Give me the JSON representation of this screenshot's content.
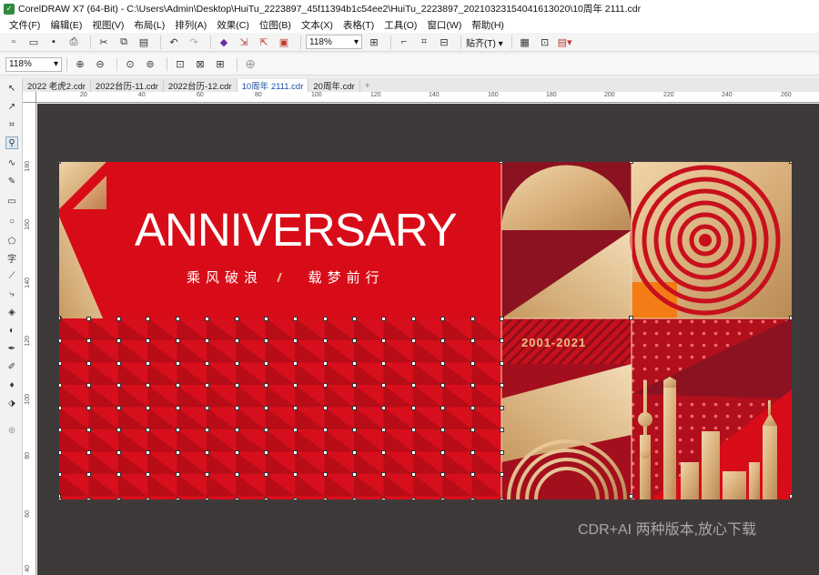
{
  "titlebar": {
    "title": "CorelDRAW X7 (64-Bit) - C:\\Users\\Admin\\Desktop\\HuiTu_2223897_45f11394b1c54ee2\\HuiTu_2223897_20210323154041613020\\10周年 2111.cdr"
  },
  "menu": {
    "items": [
      {
        "label": "文件(F)"
      },
      {
        "label": "编辑(E)"
      },
      {
        "label": "视图(V)"
      },
      {
        "label": "布局(L)"
      },
      {
        "label": "排列(A)"
      },
      {
        "label": "效果(C)"
      },
      {
        "label": "位图(B)"
      },
      {
        "label": "文本(X)"
      },
      {
        "label": "表格(T)"
      },
      {
        "label": "工具(O)"
      },
      {
        "label": "窗口(W)"
      },
      {
        "label": "帮助(H)"
      }
    ]
  },
  "toolbar": {
    "zoom": "118%",
    "snap_label": "贴齐(T)"
  },
  "propbar": {
    "zoom": "118%"
  },
  "tabs": [
    {
      "label": "2022 老虎2.cdr"
    },
    {
      "label": "2022台历-11.cdr"
    },
    {
      "label": "2022台历-12.cdr"
    },
    {
      "label": "10周年 2111.cdr"
    },
    {
      "label": "20周年.cdr"
    }
  ],
  "ruler": {
    "h_labels": [
      "20",
      "40",
      "60",
      "80",
      "100",
      "120",
      "140",
      "160",
      "180",
      "200",
      "220",
      "240",
      "260"
    ],
    "v_labels": [
      "180",
      "160",
      "140",
      "120",
      "100",
      "80",
      "60",
      "40"
    ]
  },
  "artwork": {
    "headline": "ANNIVERSARY",
    "subline_left": "乘风破浪",
    "subline_right": "载梦前行",
    "years": "2001-2021"
  },
  "watermark": "CDR+AI 两种版本,放心下载",
  "colors": {
    "red": "#d80c18",
    "dark_red": "#8b1220",
    "gold": "#d9b07c",
    "canvas": "#3f3a3a"
  }
}
